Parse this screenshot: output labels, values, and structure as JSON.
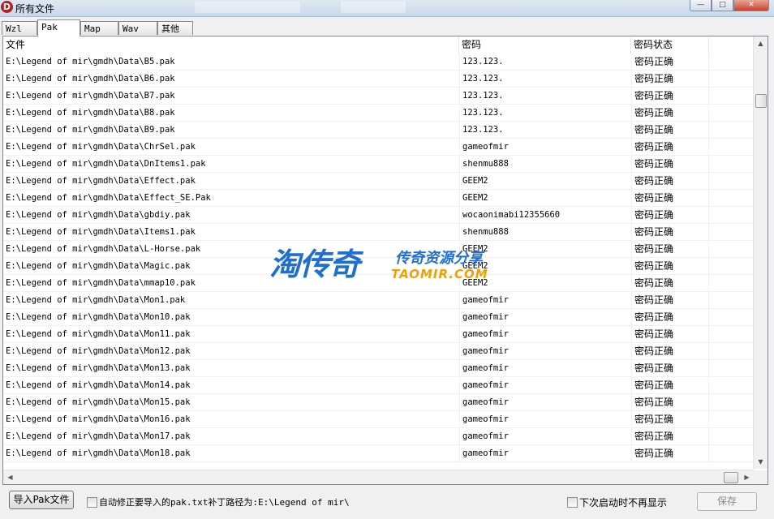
{
  "window": {
    "title": "所有文件",
    "app_icon": "D",
    "controls": [
      "minimize-icon",
      "maximize-icon",
      "close-icon"
    ]
  },
  "tabs": [
    {
      "label": "Wzl",
      "active": false
    },
    {
      "label": "Pak",
      "active": true
    },
    {
      "label": "Map",
      "active": false
    },
    {
      "label": "Wav",
      "active": false
    },
    {
      "label": "其他",
      "active": false
    }
  ],
  "table": {
    "columns": [
      "文件",
      "密码",
      "密码状态"
    ],
    "rows": [
      [
        "E:\\Legend of mir\\gmdh\\Data\\B5.pak",
        "123.123.",
        "密码正确"
      ],
      [
        "E:\\Legend of mir\\gmdh\\Data\\B6.pak",
        "123.123.",
        "密码正确"
      ],
      [
        "E:\\Legend of mir\\gmdh\\Data\\B7.pak",
        "123.123.",
        "密码正确"
      ],
      [
        "E:\\Legend of mir\\gmdh\\Data\\B8.pak",
        "123.123.",
        "密码正确"
      ],
      [
        "E:\\Legend of mir\\gmdh\\Data\\B9.pak",
        "123.123.",
        "密码正确"
      ],
      [
        "E:\\Legend of mir\\gmdh\\Data\\ChrSel.pak",
        "gameofmir",
        "密码正确"
      ],
      [
        "E:\\Legend of mir\\gmdh\\Data\\DnItems1.pak",
        "shenmu888",
        "密码正确"
      ],
      [
        "E:\\Legend of mir\\gmdh\\Data\\Effect.pak",
        "GEEM2",
        "密码正确"
      ],
      [
        "E:\\Legend of mir\\gmdh\\Data\\Effect_SE.Pak",
        "GEEM2",
        "密码正确"
      ],
      [
        "E:\\Legend of mir\\gmdh\\Data\\gbdiy.pak",
        "wocaonimabi12355660",
        "密码正确"
      ],
      [
        "E:\\Legend of mir\\gmdh\\Data\\Items1.pak",
        "shenmu888",
        "密码正确"
      ],
      [
        "E:\\Legend of mir\\gmdh\\Data\\L-Horse.pak",
        "GEEM2",
        "密码正确"
      ],
      [
        "E:\\Legend of mir\\gmdh\\Data\\Magic.pak",
        "GEEM2",
        "密码正确"
      ],
      [
        "E:\\Legend of mir\\gmdh\\Data\\mmap10.pak",
        "GEEM2",
        "密码正确"
      ],
      [
        "E:\\Legend of mir\\gmdh\\Data\\Mon1.pak",
        "gameofmir",
        "密码正确"
      ],
      [
        "E:\\Legend of mir\\gmdh\\Data\\Mon10.pak",
        "gameofmir",
        "密码正确"
      ],
      [
        "E:\\Legend of mir\\gmdh\\Data\\Mon11.pak",
        "gameofmir",
        "密码正确"
      ],
      [
        "E:\\Legend of mir\\gmdh\\Data\\Mon12.pak",
        "gameofmir",
        "密码正确"
      ],
      [
        "E:\\Legend of mir\\gmdh\\Data\\Mon13.pak",
        "gameofmir",
        "密码正确"
      ],
      [
        "E:\\Legend of mir\\gmdh\\Data\\Mon14.pak",
        "gameofmir",
        "密码正确"
      ],
      [
        "E:\\Legend of mir\\gmdh\\Data\\Mon15.pak",
        "gameofmir",
        "密码正确"
      ],
      [
        "E:\\Legend of mir\\gmdh\\Data\\Mon16.pak",
        "gameofmir",
        "密码正确"
      ],
      [
        "E:\\Legend of mir\\gmdh\\Data\\Mon17.pak",
        "gameofmir",
        "密码正确"
      ],
      [
        "E:\\Legend of mir\\gmdh\\Data\\Mon18.pak",
        "gameofmir",
        "密码正确"
      ]
    ]
  },
  "watermark": {
    "big": "淘传奇",
    "small_cn": "传奇资源分享",
    "small_en": "TAOMIR.COM",
    "colors": {
      "blue": "#1f6fd1",
      "orange": "#f0a000"
    }
  },
  "footer": {
    "import_button": "导入Pak文件",
    "auto_fix_label": "自动修正要导入的pak.txt补丁路径为:E:\\Legend of mir\\",
    "auto_fix_checked": false,
    "no_show_label": "下次启动时不再显示",
    "no_show_checked": false,
    "save_button": "保存",
    "save_enabled": false
  }
}
